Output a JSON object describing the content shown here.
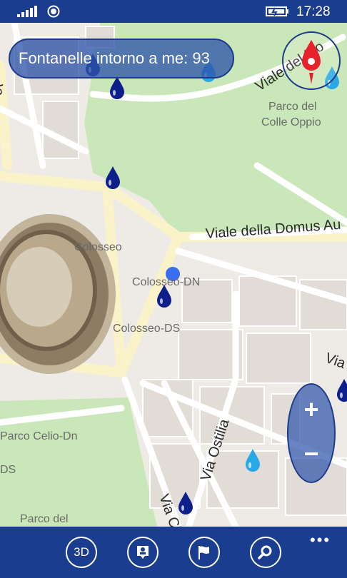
{
  "status_bar": {
    "time": "17:28"
  },
  "counter": {
    "label": "Fontanelle intorno a me: 93"
  },
  "map": {
    "labels": {
      "colosseo": "Colosseo",
      "colosseo_dn": "Colosseo-DN",
      "colosseo_ds": "Colosseo-DS",
      "parco_colle_1": "Parco del",
      "parco_colle_2": "Colle Oppio",
      "parco_celio": "Parco Celio-Dn",
      "parco_del_bottom": "Parco del",
      "ds": "DS"
    },
    "streets": {
      "viale_monte": "Viale del Mo",
      "viale_domus": "Viale della Domus Au",
      "via_ostilia": "Via Ostilia",
      "via_cla": "Via Cla",
      "via_right": "Via",
      "ale": "ale"
    }
  },
  "zoom": {
    "in": "+",
    "out": "−"
  },
  "app_bar": {
    "btn_3d": "3D",
    "more": "•••"
  },
  "colors": {
    "chrome": "#1a3d8f",
    "pin_dark": "#0d1f8a",
    "pin_light": "#29a8e6",
    "accent": "#e8222b"
  }
}
